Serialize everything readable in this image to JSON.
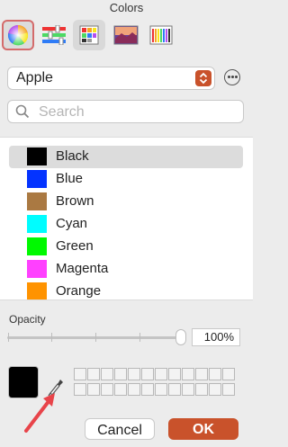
{
  "window": {
    "title": "Colors"
  },
  "toolbar": {
    "modes": [
      {
        "name": "color-wheel",
        "icon": "color-wheel-icon",
        "selected": true
      },
      {
        "name": "color-sliders",
        "icon": "sliders-icon",
        "selected": false
      },
      {
        "name": "color-palettes",
        "icon": "palettes-icon",
        "selected": true
      },
      {
        "name": "image-palettes",
        "icon": "image-palette-icon",
        "selected": false
      },
      {
        "name": "pencils",
        "icon": "pencils-icon",
        "selected": false
      }
    ]
  },
  "palette": {
    "selected": "Apple"
  },
  "search": {
    "placeholder": "Search",
    "value": ""
  },
  "colors": [
    {
      "name": "Black",
      "hex": "#000000",
      "selected": true
    },
    {
      "name": "Blue",
      "hex": "#0433ff",
      "selected": false
    },
    {
      "name": "Brown",
      "hex": "#aa7942",
      "selected": false
    },
    {
      "name": "Cyan",
      "hex": "#00fdff",
      "selected": false
    },
    {
      "name": "Green",
      "hex": "#00f900",
      "selected": false
    },
    {
      "name": "Magenta",
      "hex": "#ff40ff",
      "selected": false
    },
    {
      "name": "Orange",
      "hex": "#ff9300",
      "selected": false
    }
  ],
  "opacity": {
    "label": "Opacity",
    "value": "100%",
    "fraction": 1.0
  },
  "current_color": {
    "hex": "#000000"
  },
  "buttons": {
    "cancel": "Cancel",
    "ok": "OK"
  },
  "accent": "#c9522b",
  "annotation": {
    "arrow_color": "#e8444a"
  }
}
